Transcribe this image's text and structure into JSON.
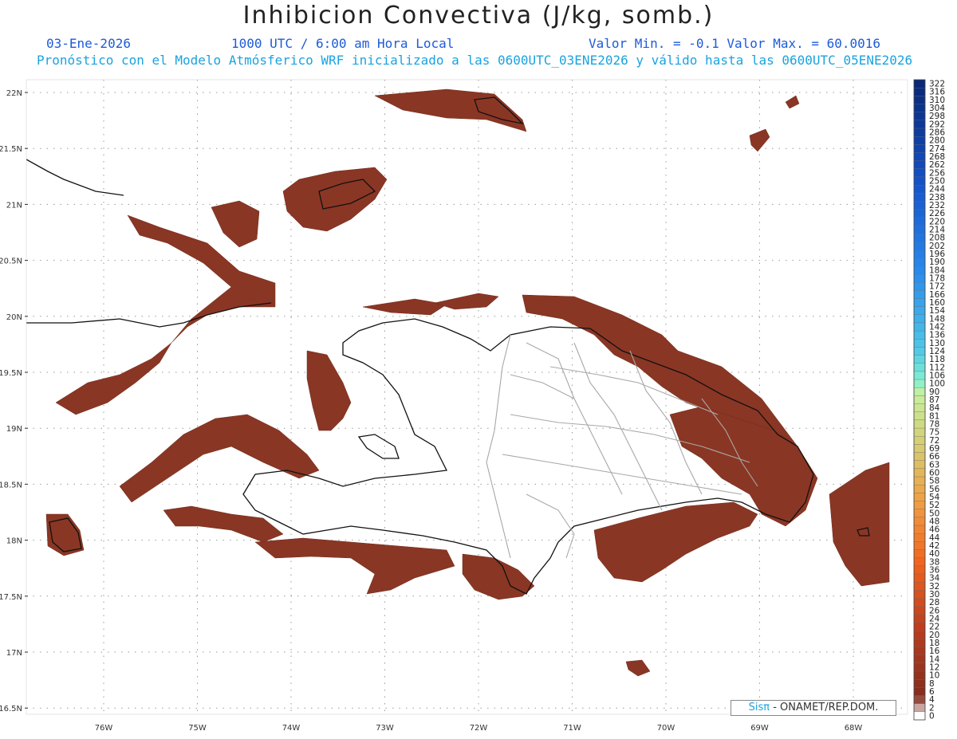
{
  "header": {
    "title": "Inhibicion Convectiva (J/kg, somb.)",
    "date": "03-Ene-2026",
    "time": "1000 UTC / 6:00 am Hora Local",
    "min_max": "Valor Min. = -0.1  Valor Max. = 60.0016",
    "subtitle": "Pronóstico con el Modelo Atmósferico WRF inicializado a las 0600UTC_03ENE2026 y válido hasta las  0600UTC_05ENE2026"
  },
  "credit": {
    "brand": "Sisπ",
    "text": "- ONAMET/REP.DOM."
  },
  "map": {
    "lat_labels": [
      "22N",
      "21.5N",
      "21N",
      "20.5N",
      "20N",
      "19.5N",
      "19N",
      "18.5N",
      "18N",
      "17.5N",
      "17N",
      "16.5N"
    ],
    "lon_labels": [
      "76W",
      "75W",
      "74W",
      "73W",
      "72W",
      "71W",
      "70W",
      "69W",
      "68W"
    ],
    "colors": {
      "field": "#8a3624",
      "coast": "#111111",
      "province": "#a8a8a8",
      "grid": "#9a9a9a"
    }
  },
  "colorbar": {
    "labels": [
      "322",
      "316",
      "310",
      "304",
      "298",
      "292",
      "286",
      "280",
      "274",
      "268",
      "262",
      "256",
      "250",
      "244",
      "238",
      "232",
      "226",
      "220",
      "214",
      "208",
      "202",
      "196",
      "190",
      "184",
      "178",
      "172",
      "166",
      "160",
      "154",
      "148",
      "142",
      "136",
      "130",
      "124",
      "118",
      "112",
      "106",
      "100",
      "90",
      "87",
      "84",
      "81",
      "78",
      "75",
      "72",
      "69",
      "66",
      "63",
      "60",
      "58",
      "56",
      "54",
      "52",
      "50",
      "48",
      "46",
      "44",
      "42",
      "40",
      "38",
      "36",
      "34",
      "32",
      "30",
      "28",
      "26",
      "24",
      "22",
      "20",
      "18",
      "16",
      "14",
      "12",
      "10",
      "8",
      "6",
      "4",
      "2",
      "0"
    ]
  }
}
